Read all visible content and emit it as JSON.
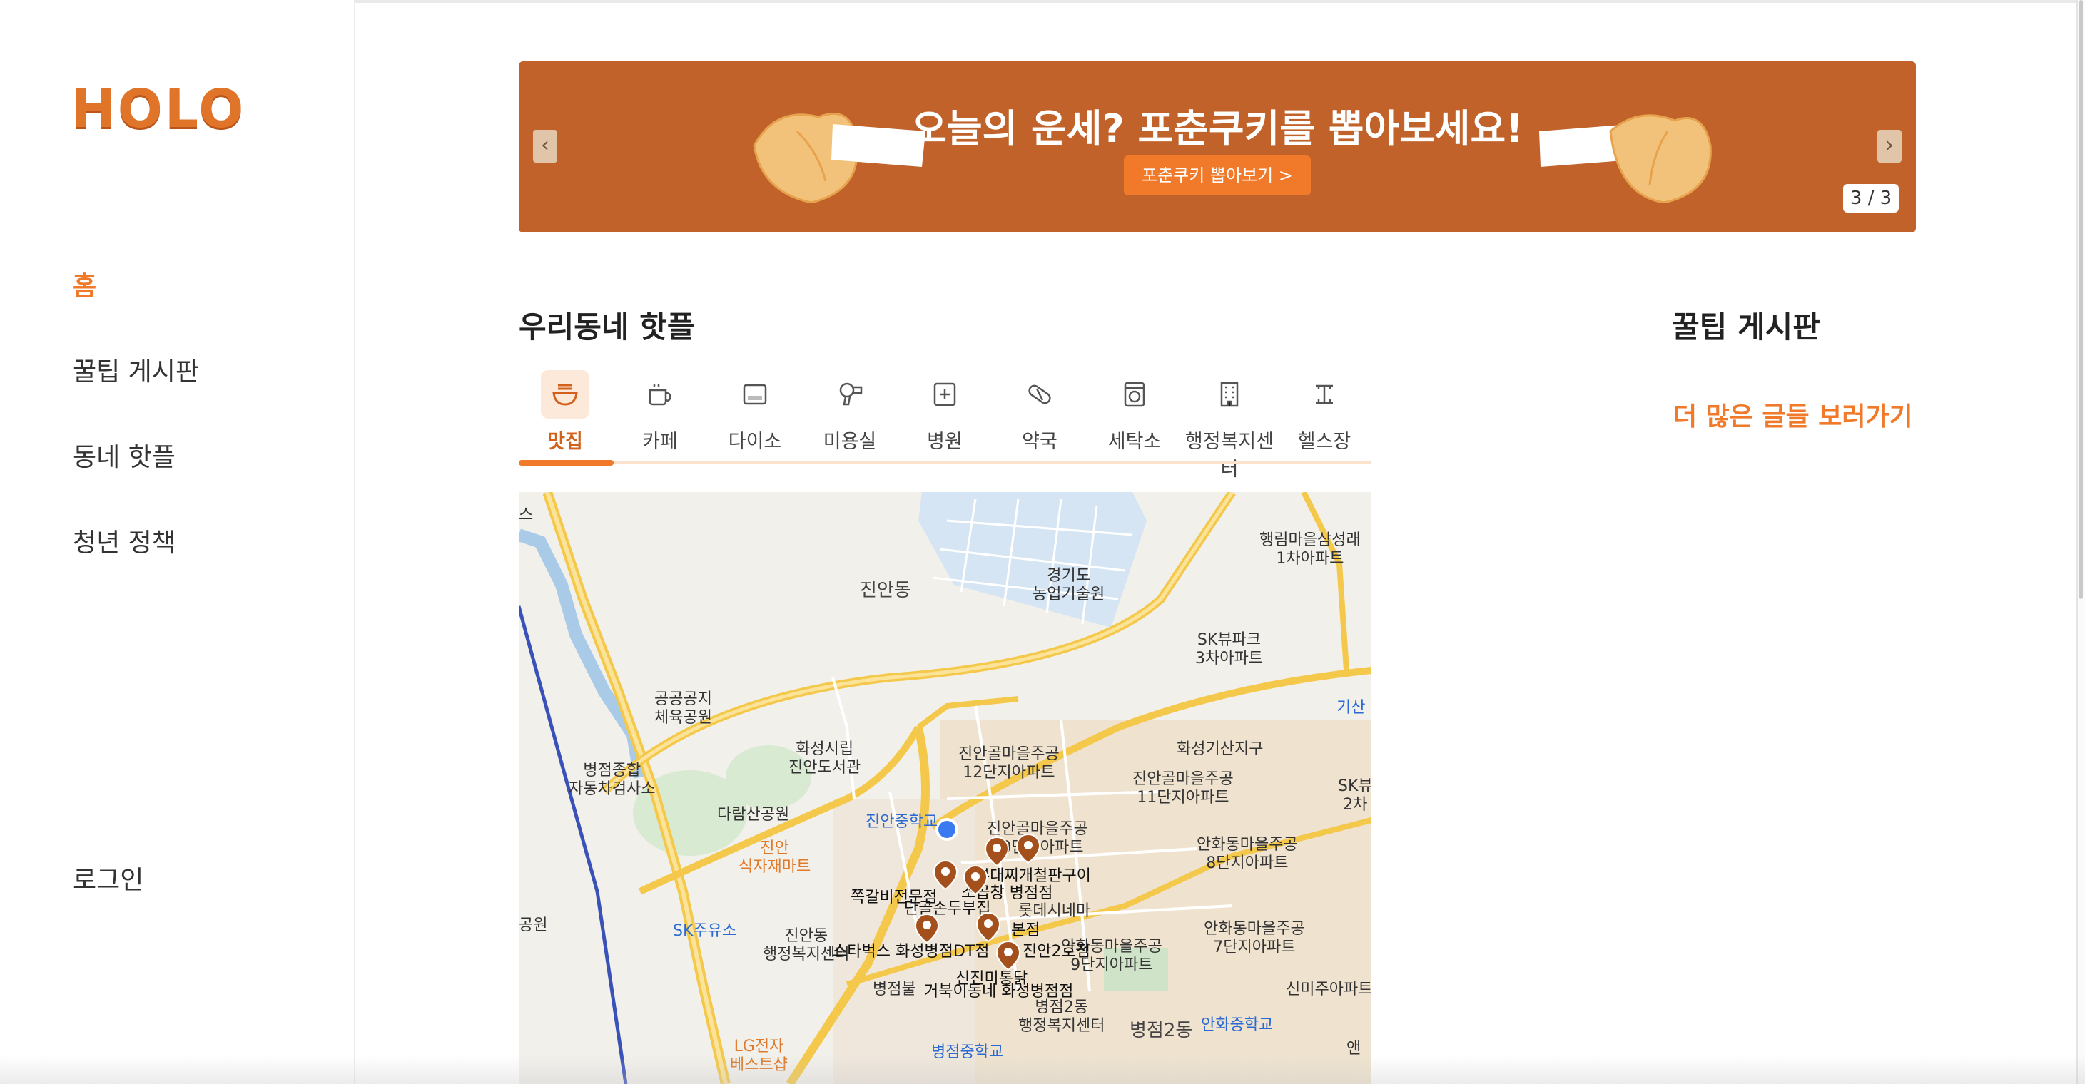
{
  "sidebar": {
    "logo": "HOLO",
    "nav": [
      {
        "label": "홈",
        "active": true
      },
      {
        "label": "꿀팁 게시판"
      },
      {
        "label": "동네 핫플"
      },
      {
        "label": "청년 정책"
      }
    ],
    "login_label": "로그인"
  },
  "banner": {
    "title": "오늘의 운세? 포춘쿠키를 뽑아보세요!",
    "cta_label": "포춘쿠키 뽑아보기 >",
    "counter": "3 / 3",
    "background_color": "#c0622a",
    "accent_color": "#f07a2a"
  },
  "hotplace": {
    "title": "우리동네 핫플",
    "categories": [
      {
        "label": "맛집",
        "icon": "bowl-icon",
        "active": true
      },
      {
        "label": "카페",
        "icon": "coffee-cup-icon"
      },
      {
        "label": "다이소",
        "icon": "store-icon"
      },
      {
        "label": "미용실",
        "icon": "hair-dryer-icon"
      },
      {
        "label": "병원",
        "icon": "hospital-icon"
      },
      {
        "label": "약국",
        "icon": "pill-icon"
      },
      {
        "label": "세탁소",
        "icon": "washing-machine-icon"
      },
      {
        "label": "행정복지센터",
        "icon": "building-icon"
      },
      {
        "label": "헬스장",
        "icon": "dumbbell-icon"
      }
    ]
  },
  "tips": {
    "title": "꿀팁 게시판",
    "more_label": "더 많은 글들 보러가기"
  },
  "map": {
    "labels": {
      "jinan_dong": "진안동",
      "agri": "경기도\n농업기술원",
      "haengrim": "행림마을삼성래\n1차아파트",
      "sk3": "SK뷰파크\n3차아파트",
      "sports": "공공공지\n체육공원",
      "library": "화성시립\n진안도서관",
      "inspect": "병점종합\n자동차검사소",
      "daram": "다람산공원",
      "jinan_mart": "진안\n식자재마트",
      "jinan_ms": "진안중학교",
      "g12": "진안골마을주공\n12단지아파트",
      "g11": "진안골마을주공\n11단지아파트",
      "g10": "진안골마을주공\n10단지아파트",
      "hwaseong_gisan": "화성기산지구",
      "anhwa8": "안화동마을주공\n8단지아파트",
      "anhwa7": "안화동마을주공\n7단지아파트",
      "g9": "안화동마을주공\n9단지아파트",
      "sk_station": "SK주유소",
      "jinan_center": "진안동\n행정복지센터",
      "lotte": "롯데시네마",
      "byeongjeom2": "병점2동\n행정복지센터",
      "byeongjeom2b": "병점2동",
      "anhwa_ms": "안화중학교",
      "byeongjeom_ms": "병점중학교",
      "lg": "LG전자\n베스트샵",
      "byeongjeom_el": "병점불",
      "park_left": "공원",
      "sinmiju": "신미주아파트",
      "gisan": "기산",
      "sk2": "SK뷰\n2차",
      "s_left": "스",
      "aeng": "앤",
      "r1": "부대찌개철판구이",
      "r2": "쪽갈비전문점",
      "r3": "소곱창 병점점",
      "r4": "단골손두부집",
      "r5": "스타벅스 화성병점DT점",
      "r6": "진안2호점",
      "r7": "신진미통닭",
      "r8": "거북이동네 화성병점점",
      "r9": "본점"
    }
  }
}
